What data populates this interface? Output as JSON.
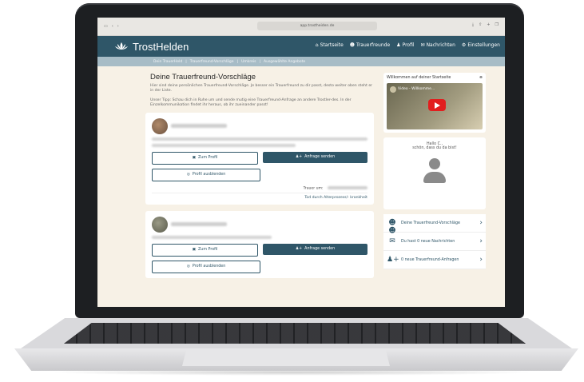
{
  "browser": {
    "url": "app.trostheiden.de"
  },
  "topnav": {
    "brand": "TrostHelden",
    "items": [
      {
        "label": "Startseite"
      },
      {
        "label": "Trauerfreunde"
      },
      {
        "label": "Profil"
      },
      {
        "label": "Nachrichten"
      },
      {
        "label": "Einstellungen"
      }
    ]
  },
  "subnav": {
    "items": [
      {
        "label": "Dein TrauerHeld"
      },
      {
        "label": "Trauerfreund-Vorschläge"
      },
      {
        "label": "Umkreis"
      },
      {
        "label": "Ausgewählte Angebote"
      }
    ]
  },
  "main": {
    "title": "Deine Trauerfreund-Vorschläge",
    "intro1": "Hier sind deine persönlichen Trauerfreund-Vorschläge. Je besser ein Trauerfreund zu dir passt, desto weiter oben steht er in der Liste.",
    "intro2": "Unser Tipp: Schau dich in Ruhe um und sende mutig eine Trauerfreund-Anfrage an andere Trostler-des. In der Einzelkommunikation findet ihr heraus, ob ihr zueinander passt!",
    "cards": [
      {
        "profile_button": "Zum Profil",
        "request_button": "Anfrage senden",
        "hide_button": "Profil ausblenden",
        "mourning_for_label": "Trauer um:",
        "cause": "Tod durch Alterprozess/- krankheit"
      },
      {
        "profile_button": "Zum Profil",
        "request_button": "Anfrage senden",
        "hide_button": "Profil ausblenden"
      }
    ]
  },
  "sidebar": {
    "welcome_title": "Willkommen auf deiner Startseite",
    "video_title": "Video - Willkomme...",
    "greeting": "Hallo C.,",
    "greeting_sub": "schön, dass du da bist!",
    "links": [
      {
        "label": "Deine Trauerfreund-Vorschläge",
        "icon": "users-icon"
      },
      {
        "label": "Du hast 0 neue Nachrichten",
        "icon": "envelope-icon"
      },
      {
        "label": "0 neue Trauerfreund-Anfragen",
        "icon": "user-plus-icon"
      }
    ]
  },
  "colors": {
    "primary": "#2f5668",
    "background": "#f7f1e6",
    "subnav": "#a7bcc6"
  }
}
